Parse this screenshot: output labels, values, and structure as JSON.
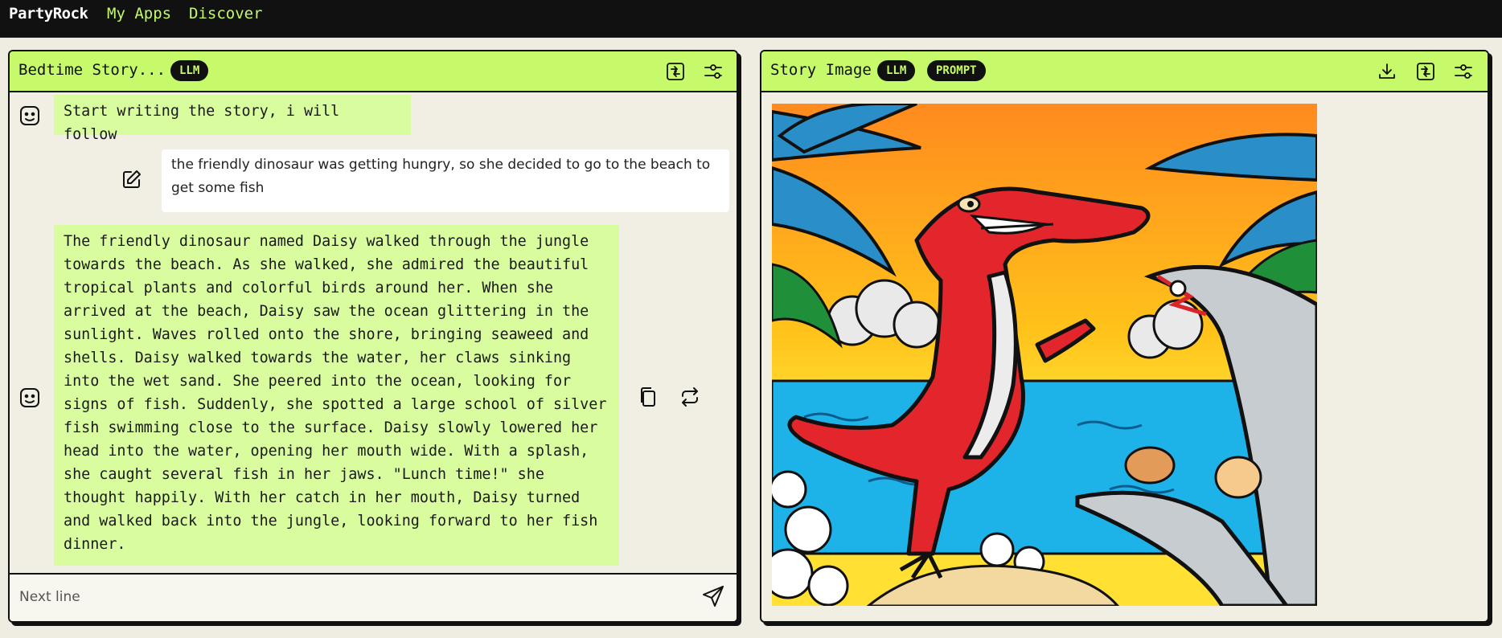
{
  "nav": {
    "brand": "PartyRock",
    "links": [
      "My Apps",
      "Discover"
    ]
  },
  "story_panel": {
    "title": "Bedtime Story...",
    "badge": "LLM",
    "header_icons": [
      "export-icon",
      "settings-sliders-icon"
    ],
    "messages": [
      {
        "role": "assistant",
        "text": "Start writing the story, i will follow"
      },
      {
        "role": "user",
        "text": "the friendly dinosaur was getting hungry, so she decided to go to the beach to get some fish"
      },
      {
        "role": "assistant",
        "lines": [
          "The friendly dinosaur named Daisy walked through the jungle",
          "towards the beach. As she walked, she admired the beautiful",
          "tropical plants and colorful birds around her. When she",
          "arrived at the beach, Daisy saw the ocean glittering in the",
          "sunlight. Waves rolled onto the shore, bringing seaweed and",
          "shells. Daisy walked towards the water, her claws sinking",
          "into the wet sand. She peered into the ocean, looking for",
          "signs of fish. Suddenly, she spotted a large school of silver",
          "fish swimming close to the surface. Daisy slowly lowered her",
          "head into the water, opening her mouth wide. With a splash,",
          "she caught several fish in her jaws. \"Lunch time!\" she",
          "thought happily. With her catch in her mouth, Daisy turned",
          "and walked back into the jungle, looking forward to her fish",
          "dinner."
        ]
      }
    ],
    "input_placeholder": "Next line"
  },
  "image_panel": {
    "title": "Story Image",
    "badges": [
      "LLM",
      "PROMPT"
    ],
    "header_icons": [
      "download-icon",
      "export-icon",
      "settings-sliders-icon"
    ]
  },
  "colors": {
    "accent": "#c6fa6a",
    "bubble": "#d9fc9f",
    "topbar": "#111111",
    "panel_bg": "#f1efe4"
  }
}
